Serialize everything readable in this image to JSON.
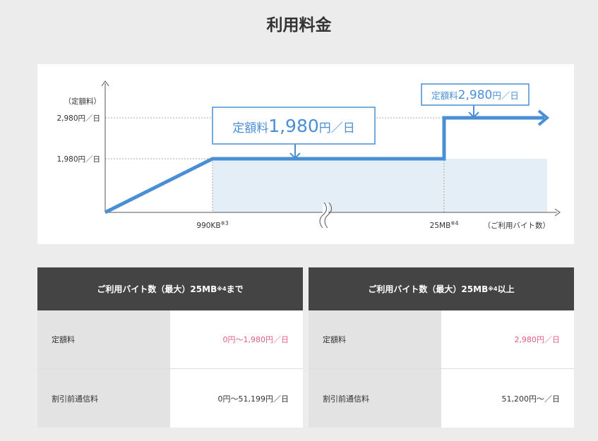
{
  "title": "利用料金",
  "chart_data": {
    "type": "line",
    "y_axis_label": "（定額料）",
    "y_ticks": [
      "1,980円／日",
      "2,980円／日"
    ],
    "x_ticks": [
      {
        "base": "990KB",
        "note": "※3"
      },
      {
        "base": "25MB",
        "note": "※4"
      }
    ],
    "x_axis_label": "（ご利用バイト数）",
    "series": [
      {
        "points": [
          {
            "x": "0",
            "y": 0
          },
          {
            "x": "990KB",
            "y": 1980
          },
          {
            "x": "25MB",
            "y": 1980
          },
          {
            "x": "25MB",
            "y": 2980
          }
        ]
      }
    ],
    "y_levels": {
      "low": 1980,
      "high": 2980
    },
    "callouts": [
      {
        "prefix": "定額料",
        "value": "1,980",
        "suffix": "円／日"
      },
      {
        "prefix": "定額料",
        "value": "2,980",
        "suffix": "円／日"
      }
    ],
    "axis_break": true,
    "colors": {
      "line": "#4a8fd6",
      "fill": "#e3eef7",
      "callout_text": "#4a8fd6"
    }
  },
  "tables": [
    {
      "header": {
        "pre": "ご利用バイト数（最大）25MB",
        "note": "※4",
        "post": "まで"
      },
      "rows": [
        {
          "label": "定額料",
          "value": "0円～1,980円／日"
        },
        {
          "label": "割引前通信料",
          "value": "0円～51,199円／日"
        }
      ]
    },
    {
      "header": {
        "pre": "ご利用バイト数（最大）25MB",
        "note": "※4",
        "post": "以上"
      },
      "rows": [
        {
          "label": "定額料",
          "value": "2,980円／日"
        },
        {
          "label": "割引前通信料",
          "value": "51,200円～／日"
        }
      ]
    }
  ]
}
